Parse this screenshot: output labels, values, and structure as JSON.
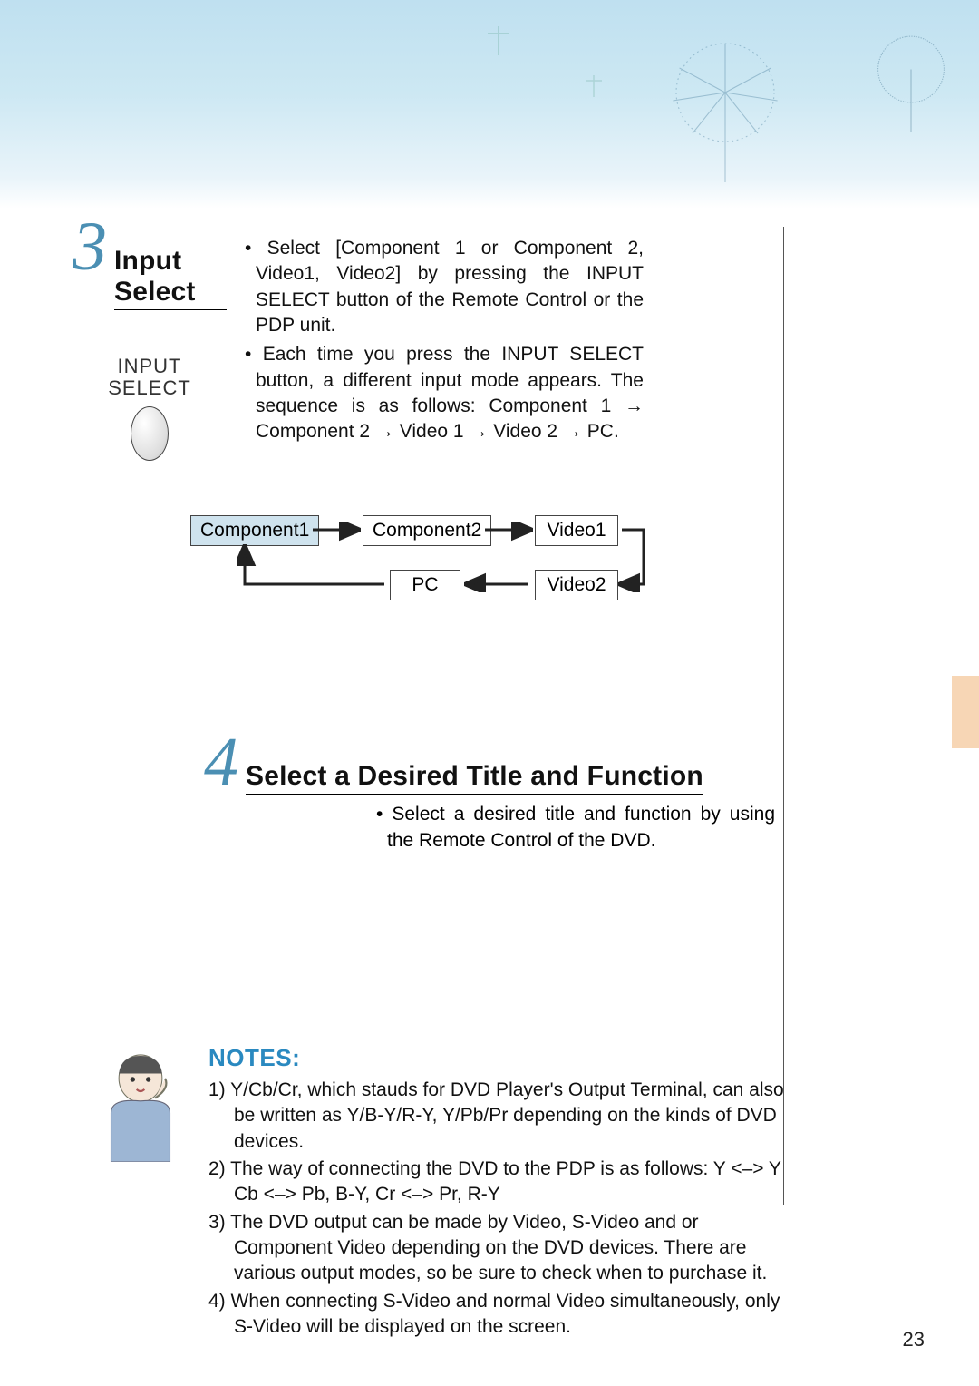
{
  "step3": {
    "number": "3",
    "title": "Input Select",
    "remote_label_line1": "INPUT",
    "remote_label_line2": "SELECT",
    "bullets": [
      "Select [Component 1 or Component 2, Video1, Video2] by pressing the INPUT SELECT button of the Remote Control or the PDP unit.",
      "Each time you press the INPUT SELECT button, a different input mode appears. The sequence is as follows: Component 1 → Component 2 → Video 1 → Video 2 → PC."
    ],
    "flow": {
      "component1": "Component1",
      "component2": "Component2",
      "video1": "Video1",
      "video2": "Video2",
      "pc": "PC"
    }
  },
  "step4": {
    "number": "4",
    "title": "Select a Desired Title and Function",
    "bullet": "Select a desired title and function by using the Remote Control of the DVD."
  },
  "notes": {
    "title": "NOTES:",
    "items": [
      "1) Y/Cb/Cr, which stauds for DVD Player's Output Terminal, can also be written as Y/B-Y/R-Y, Y/Pb/Pr depending on the kinds of DVD devices.",
      "2) The way of connecting the DVD to the PDP is as follows: Y <–> Y   Cb <–> Pb, B-Y,   Cr <–> Pr, R-Y",
      "3) The DVD output can be made by Video, S-Video and or Component Video depending on the DVD devices. There are various output modes, so be sure to check when to purchase it.",
      "4) When connecting S-Video and normal Video simultaneously, only S-Video will be displayed on the screen."
    ]
  },
  "page_number": "23"
}
